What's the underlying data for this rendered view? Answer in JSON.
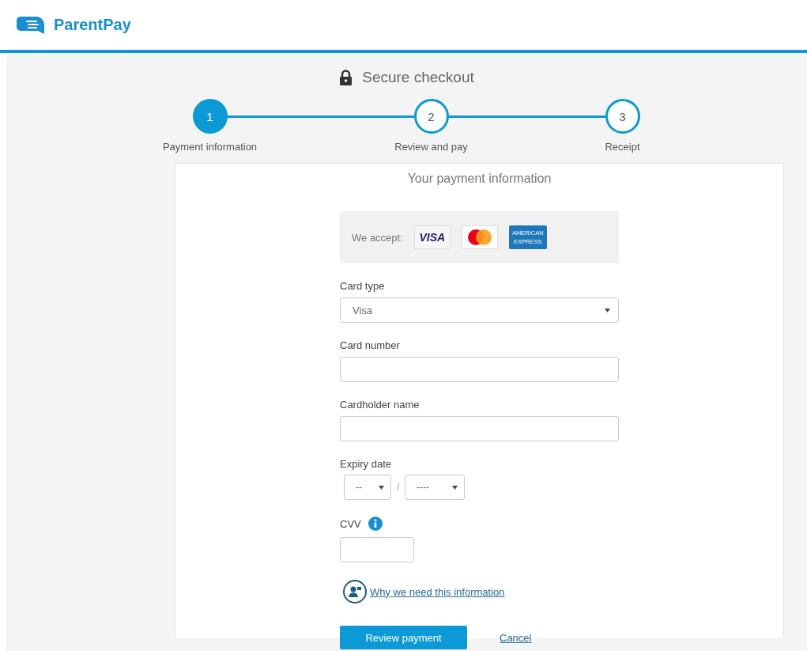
{
  "brand": {
    "name": "ParentPay"
  },
  "checkout": {
    "title": "Secure checkout"
  },
  "steps": [
    {
      "number": "1",
      "label": "Payment information",
      "selected": true
    },
    {
      "number": "2",
      "label": "Review and pay",
      "selected": false
    },
    {
      "number": "3",
      "label": "Receipt",
      "selected": false
    }
  ],
  "panel": {
    "title": "Your payment information",
    "accept": {
      "label": "We accept:",
      "cards": [
        {
          "kind": "visa",
          "text": "VISA"
        },
        {
          "kind": "mastercard"
        },
        {
          "kind": "amex",
          "lines": [
            "AMERICAN",
            "EXPRESS"
          ]
        }
      ]
    },
    "card_type": {
      "label": "Card type",
      "value": "Visa"
    },
    "card_number": {
      "label": "Card number"
    },
    "cardholder_name": {
      "label": "Cardholder name"
    },
    "expiry": {
      "label": "Expiry date",
      "month": "--",
      "separator": "/",
      "year": "----"
    },
    "cvv": {
      "label": "CVV"
    },
    "info_link": "Why we need this information",
    "buttons": {
      "primary": "Review payment",
      "cancel": "Cancel"
    }
  }
}
